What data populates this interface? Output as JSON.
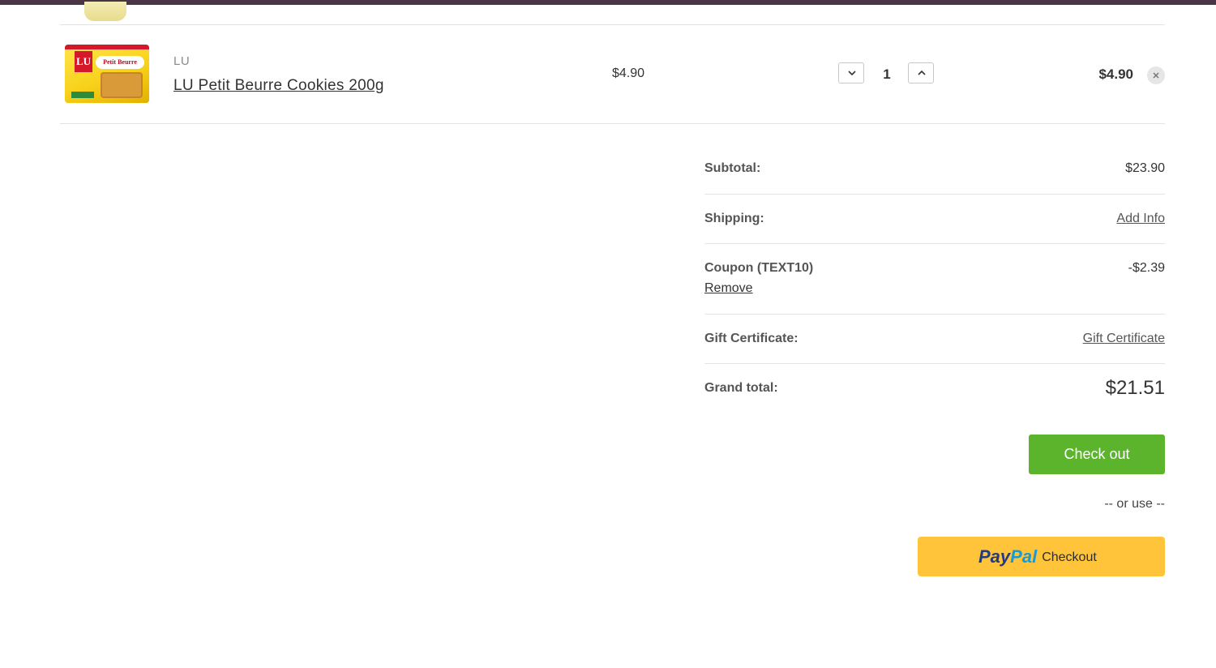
{
  "cart_item": {
    "brand": "LU",
    "name": "LU Petit Beurre Cookies 200g",
    "unit_price": "$4.90",
    "quantity": "1",
    "line_total": "$4.90",
    "thumb_logo": "LU",
    "thumb_banner": "Petit Beurre"
  },
  "icons": {
    "qty_decrease": "chevron-down-icon",
    "qty_increase": "chevron-up-icon",
    "remove": "close-icon"
  },
  "totals": {
    "subtotal_label": "Subtotal:",
    "subtotal_value": "$23.90",
    "shipping_label": "Shipping:",
    "shipping_link": "Add Info",
    "coupon_label": "Coupon (TEXT10)",
    "coupon_value": "-$2.39",
    "coupon_remove": "Remove",
    "gift_label": "Gift Certificate:",
    "gift_link": "Gift Certificate",
    "grand_label": "Grand total:",
    "grand_value": "$21.51"
  },
  "actions": {
    "checkout_label": "Check out",
    "or_use": "-- or use --",
    "paypal_pay": "Pay",
    "paypal_pal": "Pal",
    "paypal_checkout": "Checkout"
  },
  "colors": {
    "top_bar": "#4a3545",
    "checkout_green": "#5bb42c",
    "paypal_yellow": "#ffc439",
    "paypal_dark_blue": "#253b80",
    "paypal_light_blue": "#179bd7"
  }
}
